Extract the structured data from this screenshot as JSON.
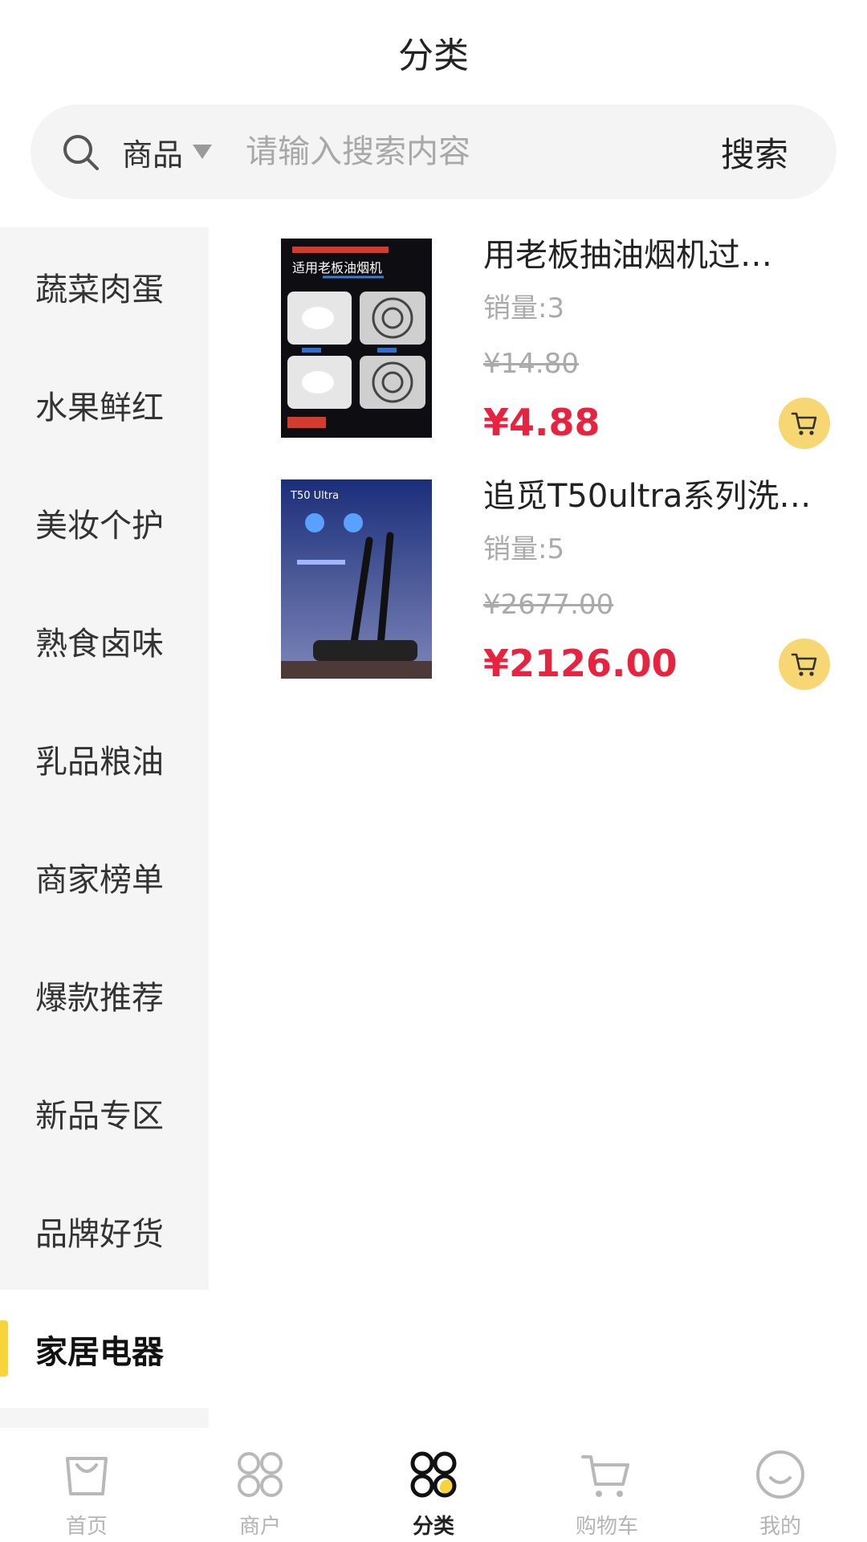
{
  "header": {
    "title": "分类"
  },
  "search": {
    "scope_label": "商品",
    "placeholder": "请输入搜索内容",
    "button_label": "搜索"
  },
  "sidebar": {
    "items": [
      {
        "label": "蔬菜肉蛋"
      },
      {
        "label": "水果鲜红"
      },
      {
        "label": "美妆个护"
      },
      {
        "label": "熟食卤味"
      },
      {
        "label": "乳品粮油"
      },
      {
        "label": "商家榜单"
      },
      {
        "label": "爆款推荐"
      },
      {
        "label": "新品专区"
      },
      {
        "label": "品牌好货"
      },
      {
        "label": "家居电器"
      }
    ],
    "active_index": 9,
    "accent_color": "#f7d43a"
  },
  "products": [
    {
      "name": "用老板抽油烟机过…",
      "sales": "销量:3",
      "original_price": "¥14.80",
      "price": "¥4.88",
      "image_text": "适用老板油烟机"
    },
    {
      "name": "追觅T50ultra系列洗…",
      "sales": "销量:5",
      "original_price": "¥2677.00",
      "price": "¥2126.00",
      "image_text": "T50 Ultra"
    }
  ],
  "tabbar": {
    "tabs": [
      {
        "label": "首页",
        "icon": "bag-icon"
      },
      {
        "label": "商户",
        "icon": "merchant-grid-icon"
      },
      {
        "label": "分类",
        "icon": "category-grid-icon"
      },
      {
        "label": "购物车",
        "icon": "cart-icon"
      },
      {
        "label": "我的",
        "icon": "smile-icon"
      }
    ],
    "active_index": 2
  },
  "colors": {
    "price_red": "#e8233f",
    "cart_button_yellow": "#f6d774",
    "active_accent": "#f7d43a"
  }
}
